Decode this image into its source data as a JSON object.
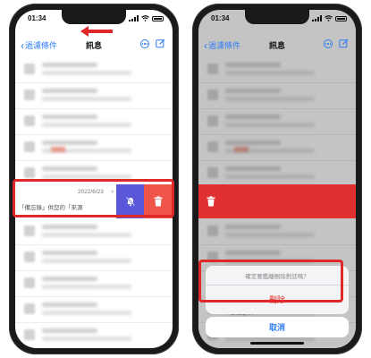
{
  "left_phone": {
    "status_time": "01:34",
    "nav": {
      "back_label": "過濾條件",
      "title": "訊息"
    },
    "swiped_row": {
      "date": "2022/6/23",
      "preview": "「備忘錄」供您的「來源",
      "chevron": ">"
    },
    "actions": {
      "mute_icon": "bell-slash-icon",
      "delete_icon": "trash-icon"
    }
  },
  "right_phone": {
    "status_time": "01:34",
    "nav": {
      "back_label": "過濾條件",
      "title": "訊息"
    },
    "red_row_icon": "trash-icon",
    "dialog": {
      "message": "確定要鑑離刪除對話嗎？",
      "delete_label": "刪除",
      "cancel_label": "取消",
      "peek_text": "1Mu0q..."
    }
  },
  "colors": {
    "ios_blue": "#2f7cf6",
    "mute_purple": "#5a57d8",
    "delete_red": "#f0554a",
    "highlight_red": "#e02828"
  }
}
